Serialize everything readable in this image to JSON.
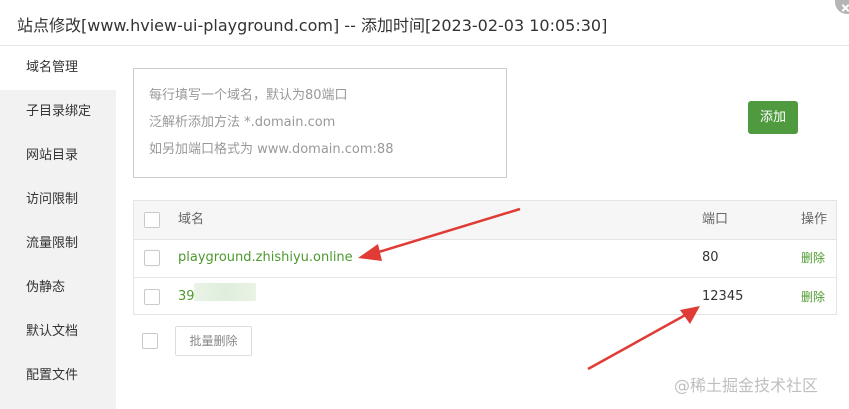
{
  "window": {
    "title": "站点修改[www.hview-ui-playground.com] -- 添加时间[2023-02-03 10:05:30]"
  },
  "sidebar": {
    "items": [
      {
        "label": "域名管理",
        "active": true
      },
      {
        "label": "子目录绑定"
      },
      {
        "label": "网站目录"
      },
      {
        "label": "访问限制"
      },
      {
        "label": "流量限制"
      },
      {
        "label": "伪静态"
      },
      {
        "label": "默认文档"
      },
      {
        "label": "配置文件"
      }
    ]
  },
  "domain_input": {
    "placeholder_lines": [
      "每行填写一个域名，默认为80端口",
      "泛解析添加方法 *.domain.com",
      "如另加端口格式为 www.domain.com:88"
    ]
  },
  "add_button": {
    "label": "添加",
    "color": "#4f9a3f"
  },
  "table": {
    "headers": {
      "domain": "域名",
      "port": "端口",
      "actions": "操作"
    },
    "rows": [
      {
        "domain": "playground.zhishiyu.online",
        "port": "80",
        "action": "删除"
      },
      {
        "domain": "39",
        "port": "12345",
        "action": "删除"
      }
    ]
  },
  "batch_delete": {
    "label": "批量删除"
  },
  "watermark": "@稀土掘金技术社区",
  "colors": {
    "accent": "#4d9a2f",
    "annotation_arrow": "#e03b35"
  }
}
